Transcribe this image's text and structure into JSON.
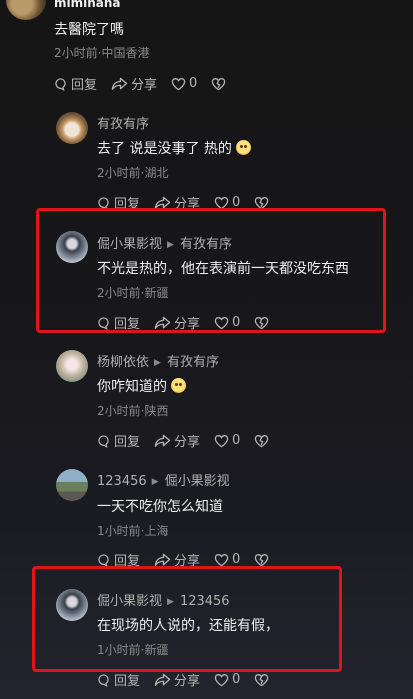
{
  "comments": [
    {
      "user": "miminana",
      "text": "去醫院了嗎",
      "meta": "2小时前·中国香港",
      "reply": "回复",
      "share": "分享",
      "likes": "0"
    },
    {
      "user": "有孜有序",
      "text": "去了 说是没事了 热的",
      "meta": "2小时前·湖北",
      "reply": "回复",
      "share": "分享",
      "likes": "0"
    },
    {
      "user": "倔小果影视",
      "reply_to": "有孜有序",
      "text": "不光是热的，他在表演前一天都没吃东西",
      "meta": "2小时前·新疆",
      "reply": "回复",
      "share": "分享",
      "likes": "0"
    },
    {
      "user": "杨柳依依",
      "reply_to": "有孜有序",
      "text": "你咋知道的",
      "meta": "2小时前·陕西",
      "reply": "回复",
      "share": "分享",
      "likes": "0"
    },
    {
      "user": "123456",
      "reply_to": "倔小果影视",
      "text": "一天不吃你怎么知道",
      "meta": "1小时前·上海",
      "reply": "回复",
      "share": "分享",
      "likes": "0"
    },
    {
      "user": "倔小果影视",
      "reply_to": "123456",
      "text": "在现场的人说的，还能有假，",
      "meta": "1小时前·新疆",
      "reply": "回复",
      "share": "分享",
      "likes": "0"
    }
  ],
  "colors": {
    "highlight": "#e0151b",
    "background": "#17171a"
  },
  "icons": [
    "comment-icon",
    "share-icon",
    "heart-icon",
    "broken-heart-icon",
    "reply-arrow-icon"
  ]
}
